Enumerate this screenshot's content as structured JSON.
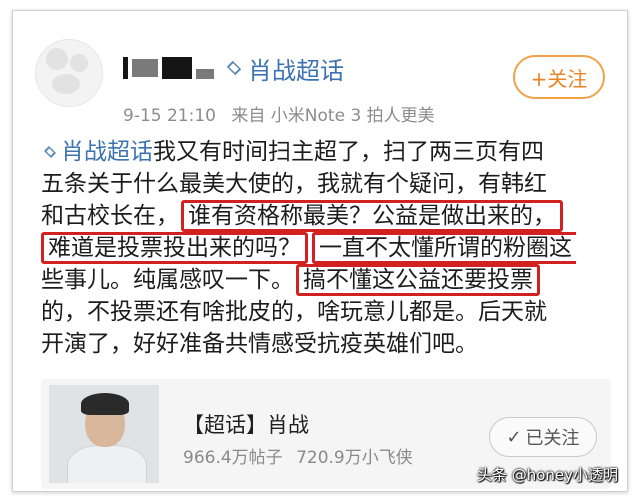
{
  "header": {
    "topic_name": "肖战超话",
    "time": "9-15 21:10",
    "source": "来自 小米Note 3 拍人更美",
    "follow_label": "+关注"
  },
  "post": {
    "topic_tag": "肖战超话",
    "lines": [
      [
        "我又有时间扫主超了，扫了两三页有四"
      ],
      [
        "五条关于什么最美大使的，我就有个疑问，有韩红"
      ],
      [
        "和古校长在，",
        "谁有资格称最美？公益是做出来的，"
      ],
      [
        "难道是投票投出来的吗？",
        "一直不太懂所谓的粉圈这"
      ],
      [
        "些事儿。纯属感叹一下。",
        "搞不懂这公益还要投票"
      ],
      [
        "的，不投票还有啥批皮的，啥玩意儿都是。后天就"
      ],
      [
        "开演了，好好准备共情感受抗疫英雄们吧。"
      ]
    ]
  },
  "card": {
    "title": "【超话】肖战",
    "posts": "966.4万帖子",
    "fans": "720.9万小飞侠",
    "followed_label": "已关注"
  },
  "watermark": "头条 @honey小透明",
  "colors": {
    "accent": "#3c73b0",
    "follow": "#e88526",
    "highlight_border": "#d12121"
  }
}
